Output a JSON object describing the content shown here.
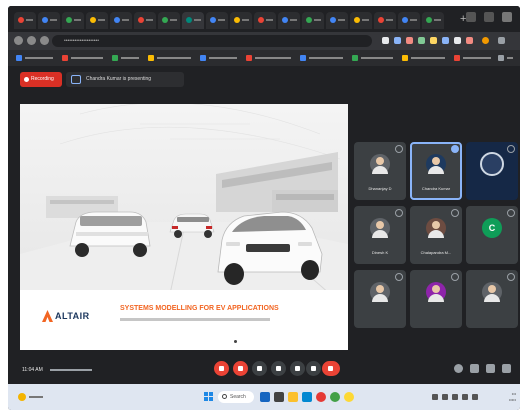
{
  "meeting": {
    "recording_label": "Recording",
    "presenter_label": "Chandra Kumar is presenting",
    "time": "11:04 AM"
  },
  "slide": {
    "brand": "ALTAIR",
    "title": "SYSTEMS MODELLING FOR EV APPLICATIONS"
  },
  "participants": [
    {
      "name": "Dhananjay D",
      "avatar": "photo",
      "speaking": false,
      "pin": false
    },
    {
      "name": "Chandra Kumar",
      "avatar": "photo",
      "speaking": true,
      "pin": true
    },
    {
      "name": "",
      "avatar": "video",
      "speaking": false,
      "pin": false
    },
    {
      "name": "Dinesh K",
      "avatar": "photo",
      "speaking": false,
      "pin": false
    },
    {
      "name": "Chalapandra M...",
      "avatar": "photo",
      "speaking": false,
      "pin": false
    },
    {
      "name": "",
      "avatar": "letter",
      "letter": "C",
      "speaking": false,
      "pin": false
    },
    {
      "name": "",
      "avatar": "photo",
      "speaking": false,
      "pin": false
    },
    {
      "name": "",
      "avatar": "photo",
      "speaking": false,
      "pin": false
    },
    {
      "name": "",
      "avatar": "photo",
      "speaking": false,
      "pin": false
    }
  ],
  "taskbar": {
    "search_label": "Search"
  },
  "colors": {
    "meet_background": "#202124",
    "tile_background": "#3c4043",
    "recording_red": "#d93025",
    "brand_navy": "#1b365d",
    "brand_orange": "#f26522",
    "speaking_outline": "#8ab4f8",
    "taskbar": "#dfe6f1"
  },
  "icons": [
    "record-dot-icon",
    "present-screen-icon",
    "pin-icon",
    "mic-off-icon",
    "camera-off-icon",
    "captions-icon",
    "emoji-icon",
    "present-icon",
    "more-options-icon",
    "leave-call-icon",
    "info-icon",
    "people-icon",
    "chat-icon",
    "activities-icon",
    "windows-start-icon",
    "search-icon"
  ]
}
